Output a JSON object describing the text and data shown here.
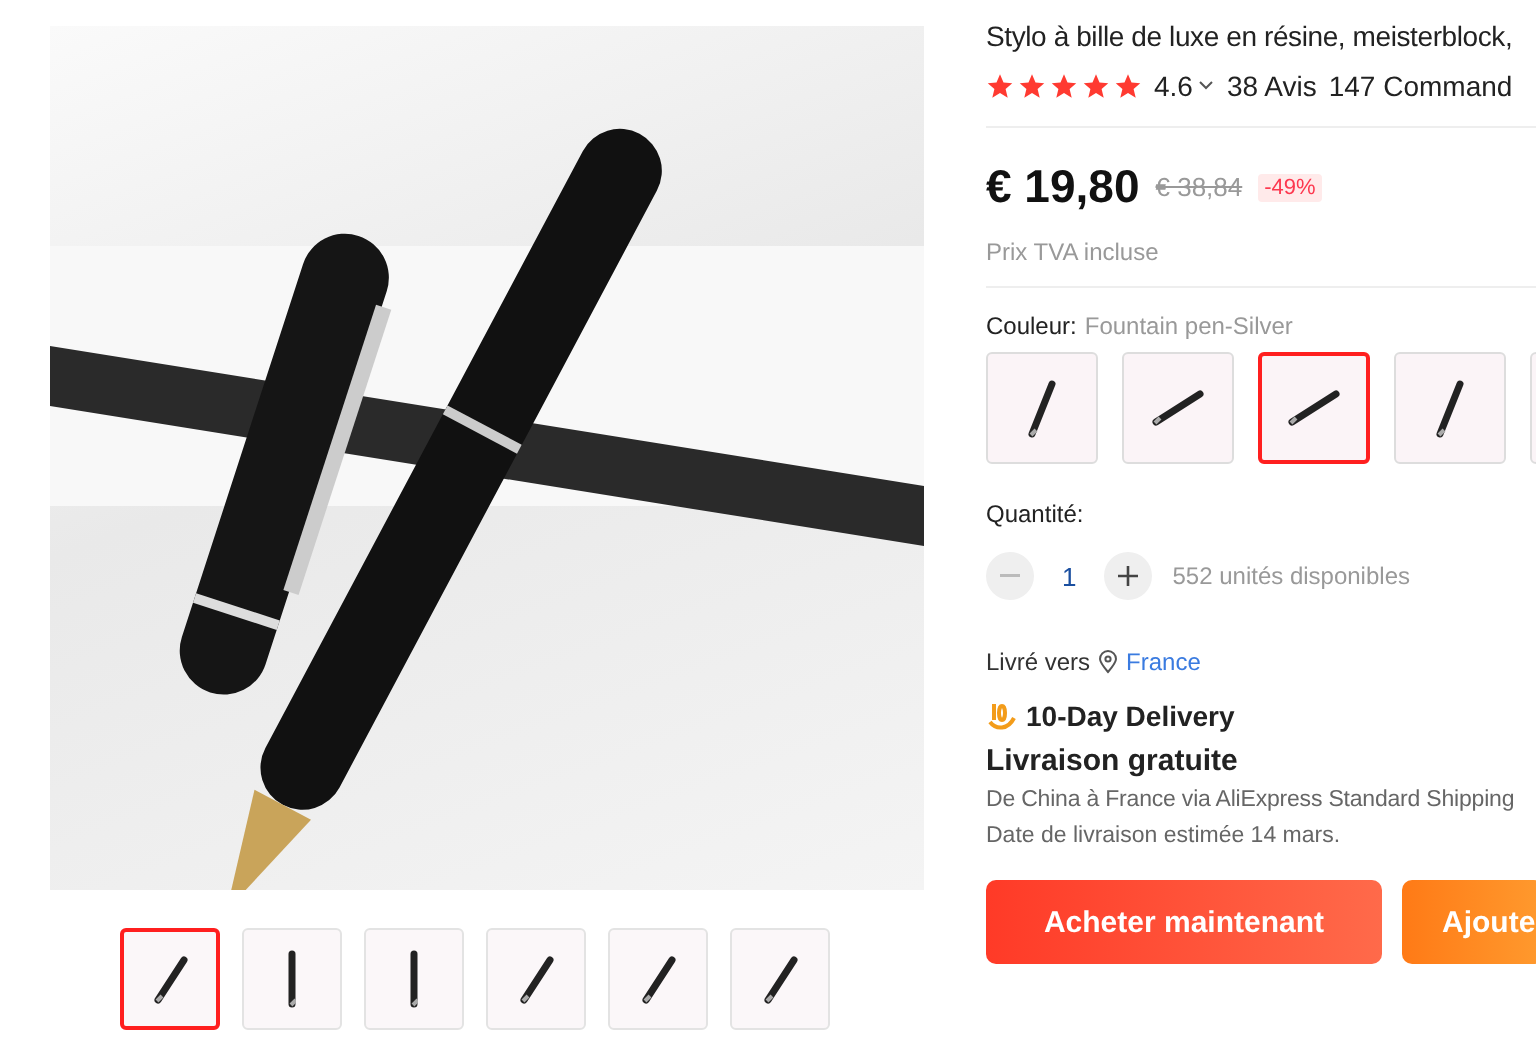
{
  "gallery": {
    "thumbnails": [
      {
        "selected": true
      },
      {
        "selected": false
      },
      {
        "selected": false
      },
      {
        "selected": false
      },
      {
        "selected": false
      },
      {
        "selected": false
      }
    ]
  },
  "product": {
    "title": "Stylo à bille de luxe en résine, meisterblock,",
    "stars": 5,
    "rating": "4.6",
    "reviews": "38 Avis",
    "orders": "147 Command",
    "price": "€ 19,80",
    "old_price": "€ 38,84",
    "discount": "-49%",
    "tax_note": "Prix TVA incluse",
    "color_label": "Couleur:",
    "color_value": "Fountain pen-Silver",
    "swatches": [
      {
        "selected": false
      },
      {
        "selected": false
      },
      {
        "selected": true
      },
      {
        "selected": false
      },
      {
        "selected": false
      }
    ],
    "quantity_label": "Quantité:",
    "quantity": "1",
    "available": "552 unités disponibles",
    "ship_label": "Livré vers",
    "ship_country": "France",
    "delivery_badge": "10-Day Delivery",
    "shipping_title": "Livraison gratuite",
    "shipping_route": "De China à France via AliExpress Standard Shipping",
    "delivery_date": "Date de livraison estimée 14 mars.",
    "buttons": [
      {
        "kind": "buy",
        "label": "Acheter maintenant"
      },
      {
        "kind": "cart",
        "label": "Ajoute"
      }
    ]
  }
}
